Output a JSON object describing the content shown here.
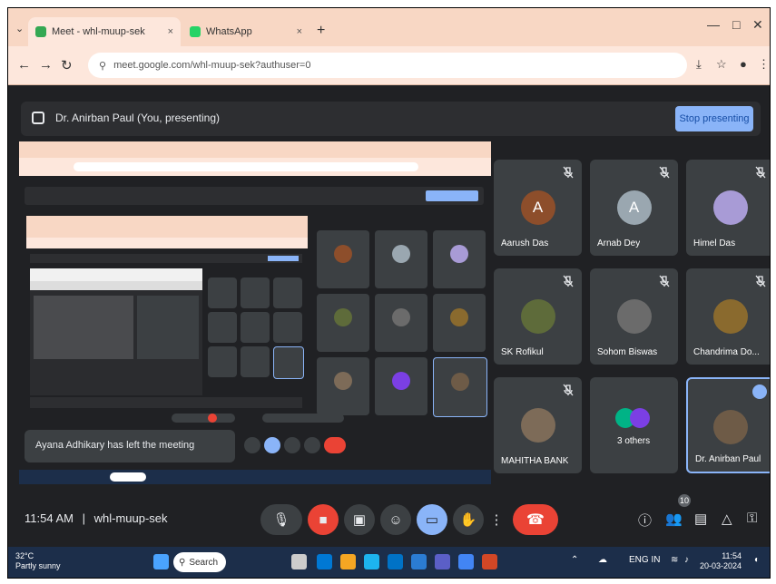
{
  "browser": {
    "tabs": [
      {
        "label": "Meet - whl-muup-sek",
        "close": "×"
      },
      {
        "label": "WhatsApp",
        "close": "×"
      }
    ],
    "new_tab": "+",
    "window_controls": [
      "⌄",
      "—",
      "□",
      "✕"
    ],
    "url": "meet.google.com/whl-muup-sek?authuser=0"
  },
  "presenting": {
    "text": "Dr. Anirban Paul (You, presenting)",
    "stop_button": "Stop presenting"
  },
  "participants": [
    {
      "name": "Aarush Das",
      "initial": "A",
      "color": "#8d4e2b"
    },
    {
      "name": "Arnab Dey",
      "initial": "A",
      "color": "#9aa7b0"
    },
    {
      "name": "Himel Das",
      "initial": "",
      "color": "#a89bd6"
    },
    {
      "name": "SK Rofikul",
      "initial": "",
      "color": "#5e6b3a"
    },
    {
      "name": "Sohom Biswas",
      "initial": "",
      "color": "#6b6b6b"
    },
    {
      "name": "Chandrima Do...",
      "initial": "",
      "color": "#8a6a2e"
    },
    {
      "name": "MAHITHA BANK",
      "initial": "",
      "color": "#7d6b58"
    },
    {
      "name": "3 others",
      "initial": "",
      "color": "#00b386"
    },
    {
      "name": "Dr. Anirban Paul",
      "initial": "",
      "color": "#6e5b47"
    }
  ],
  "shared_screen": {
    "toast": "Ayana Adhikary has left the meeting"
  },
  "controls": {
    "time": "11:54 AM",
    "meeting_code": "whl-muup-sek",
    "participant_count": "10"
  },
  "taskbar": {
    "weather_temp": "32°C",
    "weather_desc": "Partly sunny",
    "search_placeholder": "Search",
    "time": "11:54",
    "date": "20-03-2024",
    "lang": "ENG IN"
  }
}
